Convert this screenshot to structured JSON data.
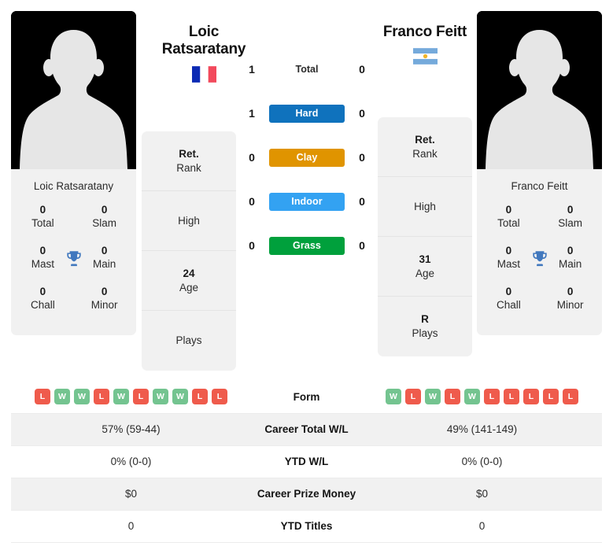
{
  "colors": {
    "card_bg": "#f1f1f1",
    "hard": "#0f72bd",
    "clay": "#e09400",
    "indoor": "#33a2f2",
    "grass": "#00a03c",
    "win": "#74c490",
    "loss": "#ef5b4c",
    "trophy": "#4178be",
    "row_shaded": "#f1f1f1",
    "row_plain": "#ffffff"
  },
  "players": {
    "left": {
      "name": "Loic Ratsaratany",
      "name_line1": "Loic",
      "name_line2": "Ratsaratany",
      "photo_caption": "Loic Ratsaratany",
      "flag": "france-flag-icon",
      "flag_name": "France",
      "titles": [
        {
          "num": "0",
          "lab": "Total"
        },
        {
          "num": "0",
          "lab": "Slam"
        },
        {
          "num": "0",
          "lab": "Mast"
        },
        {
          "num": "0",
          "lab": "Main"
        },
        {
          "num": "0",
          "lab": "Chall"
        },
        {
          "num": "0",
          "lab": "Minor"
        }
      ],
      "info": [
        {
          "val": "Ret.",
          "lab": "Rank"
        },
        {
          "val": "",
          "lab": "High"
        },
        {
          "val": "24",
          "lab": "Age"
        },
        {
          "val": "",
          "lab": "Plays"
        }
      ],
      "form": [
        "L",
        "W",
        "W",
        "L",
        "W",
        "L",
        "W",
        "W",
        "L",
        "L"
      ],
      "career_total_wl": "57% (59-44)",
      "ytd_wl": "0% (0-0)",
      "career_prize_money": "$0",
      "ytd_titles": "0"
    },
    "right": {
      "name": "Franco Feitt",
      "name_line1": "Franco Feitt",
      "name_line2": "",
      "photo_caption": "Franco Feitt",
      "flag": "argentina-flag-icon",
      "flag_name": "Argentina",
      "titles": [
        {
          "num": "0",
          "lab": "Total"
        },
        {
          "num": "0",
          "lab": "Slam"
        },
        {
          "num": "0",
          "lab": "Mast"
        },
        {
          "num": "0",
          "lab": "Main"
        },
        {
          "num": "0",
          "lab": "Chall"
        },
        {
          "num": "0",
          "lab": "Minor"
        }
      ],
      "info": [
        {
          "val": "Ret.",
          "lab": "Rank"
        },
        {
          "val": "",
          "lab": "High"
        },
        {
          "val": "31",
          "lab": "Age"
        },
        {
          "val": "R",
          "lab": "Plays"
        }
      ],
      "form": [
        "W",
        "L",
        "W",
        "L",
        "W",
        "L",
        "L",
        "L",
        "L",
        "L"
      ],
      "career_total_wl": "49% (141-149)",
      "ytd_wl": "0% (0-0)",
      "career_prize_money": "$0",
      "ytd_titles": "0"
    }
  },
  "h2h": [
    {
      "label": "Total",
      "left": "1",
      "right": "0",
      "style": "plain"
    },
    {
      "label": "Hard",
      "left": "1",
      "right": "0",
      "style": "hard"
    },
    {
      "label": "Clay",
      "left": "0",
      "right": "0",
      "style": "clay"
    },
    {
      "label": "Indoor",
      "left": "0",
      "right": "0",
      "style": "indoor"
    },
    {
      "label": "Grass",
      "left": "0",
      "right": "0",
      "style": "grass"
    }
  ],
  "table": {
    "rows": [
      {
        "label": "Form",
        "key": "form",
        "type": "form"
      },
      {
        "label": "Career Total W/L",
        "key": "career_total_wl",
        "type": "text"
      },
      {
        "label": "YTD W/L",
        "key": "ytd_wl",
        "type": "text"
      },
      {
        "label": "Career Prize Money",
        "key": "career_prize_money",
        "type": "text"
      },
      {
        "label": "YTD Titles",
        "key": "ytd_titles",
        "type": "text"
      }
    ]
  }
}
